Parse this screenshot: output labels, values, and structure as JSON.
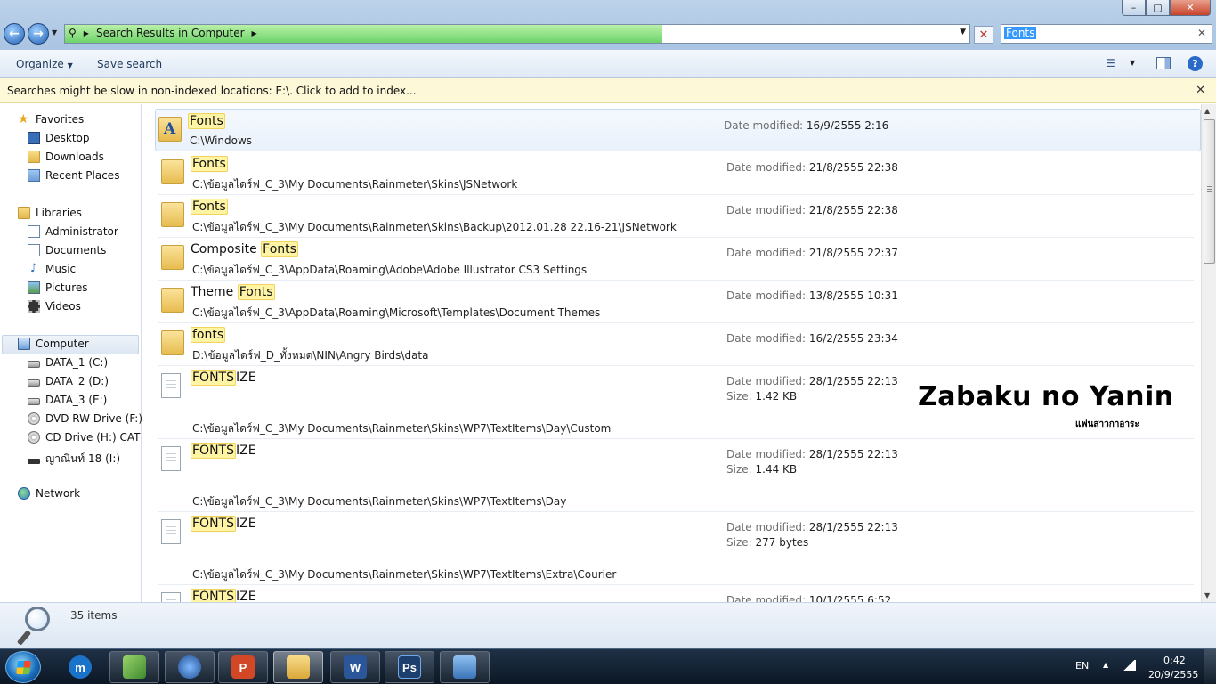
{
  "address": {
    "crumb": "Search Results in Computer",
    "progress": 0.66
  },
  "search": {
    "query": "Fonts"
  },
  "window": {
    "minimize": "–",
    "maximize": "▢",
    "close": "✕"
  },
  "commands": {
    "organize": "Organize",
    "save_search": "Save search",
    "help": "?"
  },
  "infobar": {
    "text": "Searches might be slow in non-indexed locations: E:\\. Click to add to index..."
  },
  "sidebar": {
    "favorites": {
      "label": "Favorites",
      "items": [
        "Desktop",
        "Downloads",
        "Recent Places"
      ]
    },
    "libraries": {
      "label": "Libraries",
      "items": [
        "Administrator",
        "Documents",
        "Music",
        "Pictures",
        "Videos"
      ]
    },
    "computer": {
      "label": "Computer",
      "items": [
        "DATA_1 (C:)",
        "DATA_2 (D:)",
        "DATA_3 (E:)",
        "DVD RW Drive (F:)",
        "CD Drive (H:) CAT C",
        "ญาณินท์ 18 (I:)"
      ]
    },
    "network": {
      "label": "Network"
    }
  },
  "labels": {
    "date_modified": "Date modified:",
    "size": "Size:"
  },
  "results": [
    {
      "name_pre": "",
      "name_hl": "Fonts",
      "name_post": "",
      "path": "C:\\Windows",
      "date": "16/9/2555 2:16",
      "icon": "fonts-folder-icon"
    },
    {
      "name_pre": "",
      "name_hl": "Fonts",
      "name_post": "",
      "path": "C:\\ข้อมูลไดร์ฟ_C_3\\My Documents\\Rainmeter\\Skins\\JSNetwork",
      "date": "21/8/2555 22:38",
      "icon": "folder-icon"
    },
    {
      "name_pre": "",
      "name_hl": "Fonts",
      "name_post": "",
      "path": "C:\\ข้อมูลไดร์ฟ_C_3\\My Documents\\Rainmeter\\Skins\\Backup\\2012.01.28 22.16-21\\JSNetwork",
      "date": "21/8/2555 22:38",
      "icon": "folder-icon"
    },
    {
      "name_pre": "Composite ",
      "name_hl": "Fonts",
      "name_post": "",
      "path": "C:\\ข้อมูลไดร์ฟ_C_3\\AppData\\Roaming\\Adobe\\Adobe Illustrator CS3 Settings",
      "date": "21/8/2555 22:37",
      "icon": "folder-icon"
    },
    {
      "name_pre": "Theme ",
      "name_hl": "Fonts",
      "name_post": "",
      "path": "C:\\ข้อมูลไดร์ฟ_C_3\\AppData\\Roaming\\Microsoft\\Templates\\Document Themes",
      "date": "13/8/2555 10:31",
      "icon": "folder-icon"
    },
    {
      "name_pre": "",
      "name_hl": "fonts",
      "name_post": "",
      "path": "D:\\ข้อมูลไดร์ฟ_D_ทั้งหมด\\NIN\\Angry Birds\\data",
      "date": "16/2/2555 23:34",
      "icon": "folder-icon"
    },
    {
      "name_pre": "",
      "name_hl": "FONTS",
      "name_post": "IZE",
      "path": "C:\\ข้อมูลไดร์ฟ_C_3\\My Documents\\Rainmeter\\Skins\\WP7\\TextItems\\Day\\Custom",
      "date": "28/1/2555 22:13",
      "size": "1.42 KB",
      "icon": "file-icon"
    },
    {
      "name_pre": "",
      "name_hl": "FONTS",
      "name_post": "IZE",
      "path": "C:\\ข้อมูลไดร์ฟ_C_3\\My Documents\\Rainmeter\\Skins\\WP7\\TextItems\\Day",
      "date": "28/1/2555 22:13",
      "size": "1.44 KB",
      "icon": "file-icon"
    },
    {
      "name_pre": "",
      "name_hl": "FONTS",
      "name_post": "IZE",
      "path": "C:\\ข้อมูลไดร์ฟ_C_3\\My Documents\\Rainmeter\\Skins\\WP7\\TextItems\\Extra\\Courier",
      "date": "28/1/2555 22:13",
      "size": "277 bytes",
      "icon": "file-icon"
    },
    {
      "name_pre": "",
      "name_hl": "FONTS",
      "name_post": "IZE",
      "path": "",
      "date": "10/1/2555 6:52",
      "icon": "file-icon"
    }
  ],
  "watermark": {
    "title": "Zabaku no Yanin",
    "subtitle": "แฟนสาวกาอาระ"
  },
  "details": {
    "count": "35 items"
  },
  "taskbar": {
    "apps": [
      {
        "name": "maxthon-icon",
        "glyph": "m",
        "color": "#1a73c9"
      },
      {
        "name": "windows-live-icon",
        "glyph": "",
        "color": "#6aa84f"
      },
      {
        "name": "globe-app-icon",
        "glyph": "",
        "color": "#2a5fa0"
      },
      {
        "name": "powerpoint-icon",
        "glyph": "P",
        "color": "#d24726"
      },
      {
        "name": "explorer-icon",
        "glyph": "",
        "color": "#e2b84c"
      },
      {
        "name": "word-icon",
        "glyph": "W",
        "color": "#2b579a"
      },
      {
        "name": "photoshop-icon",
        "glyph": "Ps",
        "color": "#1d3f6e"
      },
      {
        "name": "control-panel-icon",
        "glyph": "",
        "color": "#4a86c8"
      }
    ],
    "lang": "EN",
    "time": "0:42",
    "date": "20/9/2555"
  }
}
